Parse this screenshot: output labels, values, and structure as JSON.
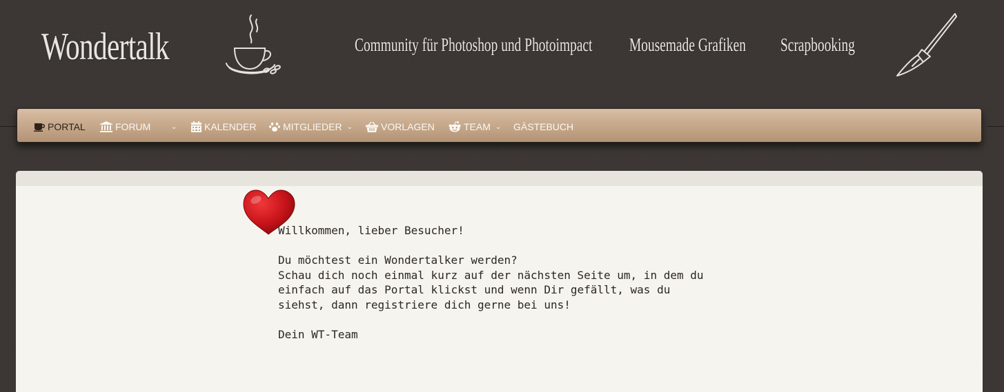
{
  "header": {
    "logo": "Wondertalk",
    "taglines": [
      "Community für Photoshop und Photoimpact",
      "Mousemade Grafiken",
      "Scrapbooking"
    ],
    "icons": [
      "coffee-cup-icon",
      "paintbrush-icon"
    ]
  },
  "nav": {
    "items": [
      {
        "label": "PORTAL",
        "icon": "coffee-icon",
        "active": true
      },
      {
        "label": "FORUM",
        "icon": "bank-icon",
        "dropdown": true
      },
      {
        "label": "KALENDER",
        "icon": "calendar-icon"
      },
      {
        "label": "MITGLIEDER",
        "icon": "paw-icon",
        "dropdown": true
      },
      {
        "label": "VORLAGEN",
        "icon": "basket-icon"
      },
      {
        "label": "TEAM",
        "icon": "reddit-icon",
        "dropdown": true
      },
      {
        "label": "GÄSTEBUCH"
      }
    ]
  },
  "main": {
    "welcome_text": "Willkommen, lieber Besucher!\n\nDu möchtest ein Wondertalker werden?\nSchau dich noch einmal kurz auf der nächsten Seite um, in dem du\neinfach auf das Portal klickst und wenn Dir gefällt, was du\nsiehst, dann registriere dich gerne bei uns!\n\nDein WT-Team",
    "decoration": "heart-icon"
  },
  "colors": {
    "background": "#3a3532",
    "nav_gradient_top": "#d8bea3",
    "nav_gradient_bottom": "#b49375",
    "content_bg": "#f6f4ef",
    "heart": "#c8141a"
  }
}
